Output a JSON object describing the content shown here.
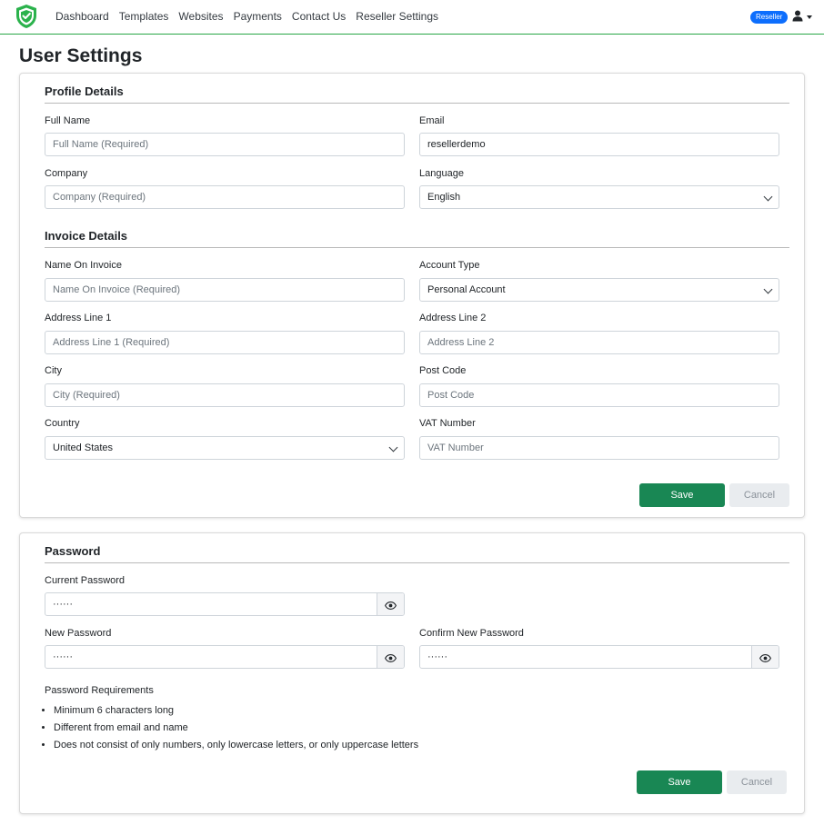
{
  "nav": {
    "links": [
      "Dashboard",
      "Templates",
      "Websites",
      "Payments",
      "Contact Us",
      "Reseller Settings"
    ],
    "badge": "Reseller"
  },
  "page": {
    "title": "User Settings"
  },
  "profile": {
    "title": "Profile Details",
    "full_name": {
      "label": "Full Name",
      "placeholder": "Full Name (Required)",
      "value": ""
    },
    "email": {
      "label": "Email",
      "value": "resellerdemo"
    },
    "company": {
      "label": "Company",
      "placeholder": "Company (Required)",
      "value": ""
    },
    "language": {
      "label": "Language",
      "value": "English"
    }
  },
  "invoice": {
    "title": "Invoice Details",
    "name_on_invoice": {
      "label": "Name On Invoice",
      "placeholder": "Name On Invoice (Required)"
    },
    "account_type": {
      "label": "Account Type",
      "value": "Personal Account"
    },
    "address1": {
      "label": "Address Line 1",
      "placeholder": "Address Line 1 (Required)"
    },
    "address2": {
      "label": "Address Line 2",
      "placeholder": "Address Line 2"
    },
    "city": {
      "label": "City",
      "placeholder": "City (Required)"
    },
    "post_code": {
      "label": "Post Code",
      "placeholder": "Post Code"
    },
    "country": {
      "label": "Country",
      "value": "United States"
    },
    "vat": {
      "label": "VAT Number",
      "placeholder": "VAT Number"
    },
    "save_label": "Save",
    "cancel_label": "Cancel"
  },
  "password": {
    "title": "Password",
    "current": {
      "label": "Current Password",
      "value": "······"
    },
    "new": {
      "label": "New Password",
      "value": "······"
    },
    "confirm": {
      "label": "Confirm New Password",
      "value": "······"
    },
    "requirements_title": "Password Requirements",
    "requirements": [
      "Minimum 6 characters long",
      "Different from email and name",
      "Does not consist of only numbers, only lowercase letters, or only uppercase letters"
    ],
    "save_label": "Save",
    "cancel_label": "Cancel"
  },
  "colors": {
    "accent": "#198754",
    "badge": "#0d6efd",
    "logo": "#2bb24c"
  }
}
